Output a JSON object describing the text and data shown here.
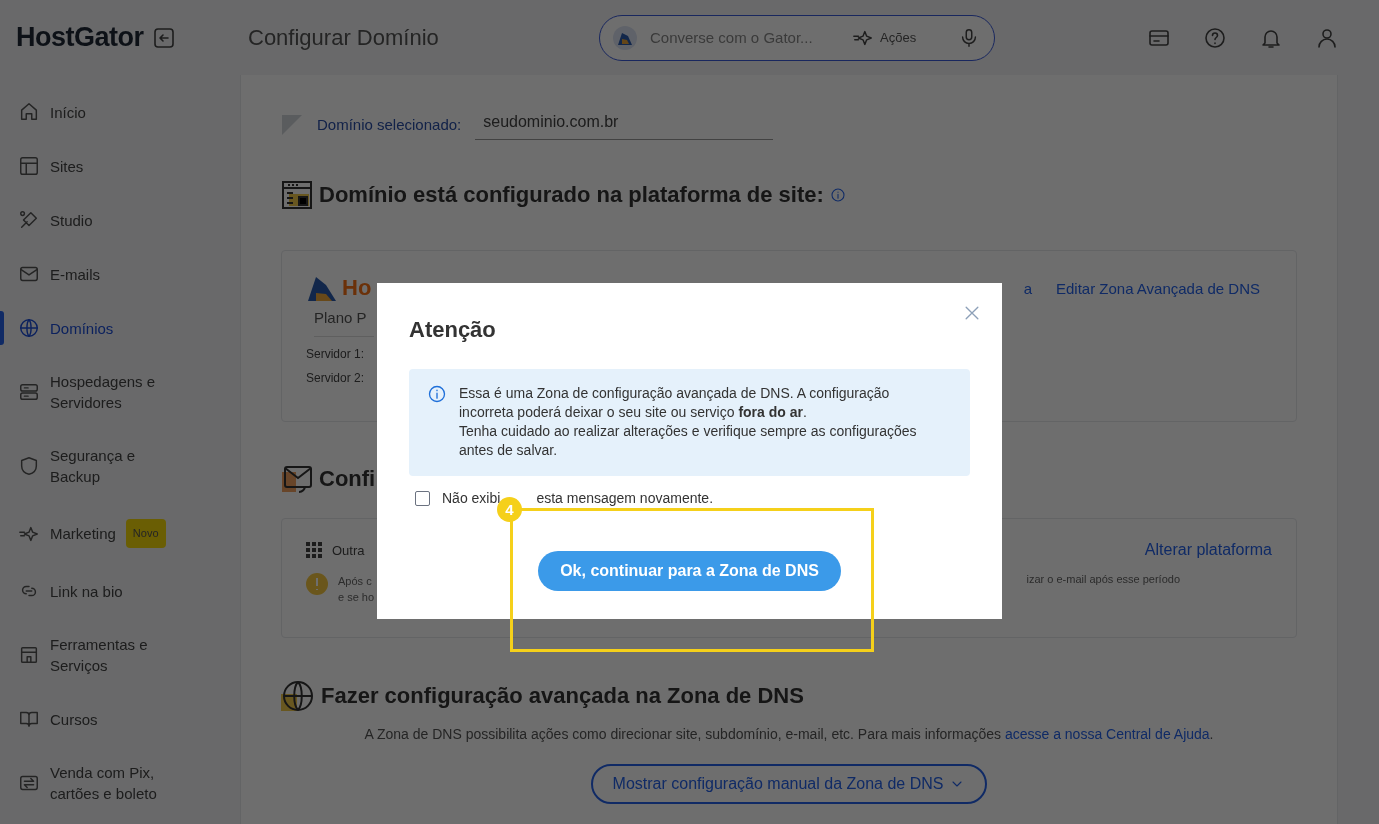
{
  "header": {
    "logo": "HostGator",
    "title": "Configurar Domínio",
    "search": {
      "placeholder": "Converse com o Gator...",
      "actions": "Ações"
    }
  },
  "sidebar": {
    "items": [
      {
        "label": "Início",
        "selected": false
      },
      {
        "label": "Sites",
        "selected": false
      },
      {
        "label": "Studio",
        "selected": false
      },
      {
        "label": "E-mails",
        "selected": false
      },
      {
        "label": "Domínios",
        "selected": true
      },
      {
        "label": "Hospedagens e Servidores",
        "selected": false
      },
      {
        "label": "Segurança e Backup",
        "selected": false
      },
      {
        "label": "Marketing",
        "selected": false,
        "badge": "Novo"
      },
      {
        "label": "Link na bio",
        "selected": false
      },
      {
        "label": "Ferramentas e Serviços",
        "selected": false
      },
      {
        "label": "Cursos",
        "selected": false
      },
      {
        "label": "Venda com Pix, cartões e boleto",
        "selected": false
      }
    ]
  },
  "domain": {
    "label": "Domínio selecionado:",
    "value": "seudominio.com.br"
  },
  "platform_section": {
    "heading": "Domínio está configurado na plataforma de site:",
    "card": {
      "brand": "Ho",
      "plan": "Plano P",
      "servers": [
        "Servidor 1:",
        "Servidor 2:"
      ],
      "links": [
        "a",
        "Editar Zona Avançada de DNS"
      ]
    }
  },
  "email_section": {
    "heading": "Confi",
    "card": {
      "label": "Outra",
      "link": "Alterar plataforma",
      "notice_left": [
        "Após c",
        "e se ho"
      ],
      "notice_right": "izar o e-mail após esse período"
    }
  },
  "dns_section": {
    "heading": "Fazer configuração avançada na Zona de DNS",
    "text": "A Zona de DNS possibilita ações como direcionar site, subdomínio, e-mail, etc. Para mais informações",
    "link": "acesse a nossa Central de Ajuda",
    "text_end": ".",
    "button": "Mostrar configuração manual da Zona de DNS"
  },
  "modal": {
    "title": "Atenção",
    "alert": [
      "Essa é uma Zona de configuração avançada de DNS. A configuração incorreta poderá deixar o seu site ou serviço **fora do ar**.",
      "Tenha cuidado ao realizar alterações e verifique sempre as configurações antes de salvar."
    ],
    "checkbox": {
      "label": "Não exibi",
      "label_rest": "esta mensagem novamente.",
      "checked": false
    },
    "button": "Ok, continuar para a Zona de DNS"
  },
  "annotation": {
    "number": "4"
  }
}
